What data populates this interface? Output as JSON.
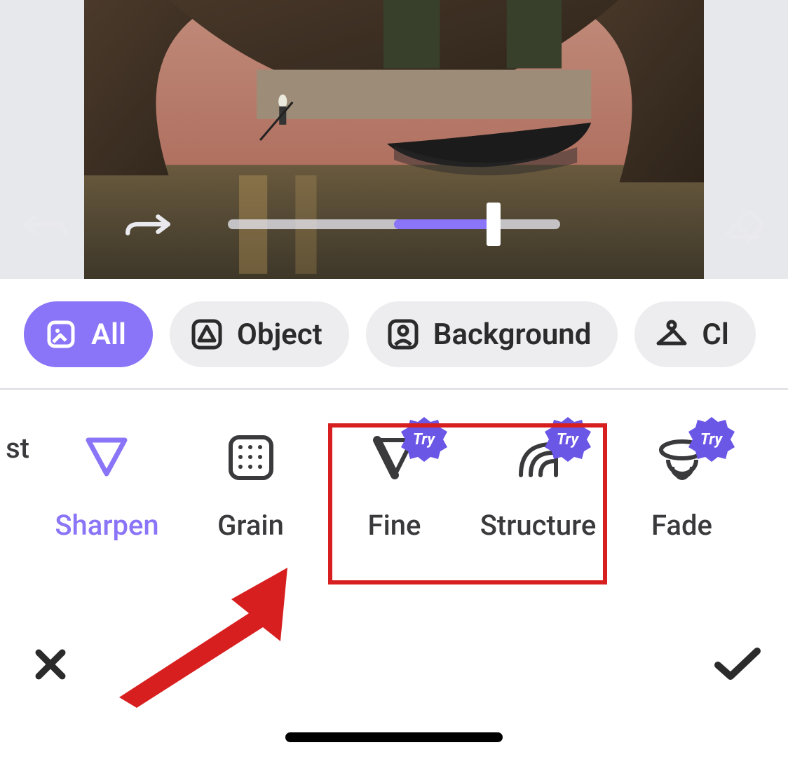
{
  "slider": {
    "center_pct": 50,
    "value_pct": 80
  },
  "scope_tabs": [
    {
      "id": "all",
      "label": "All",
      "icon": "layer-icon",
      "active": true
    },
    {
      "id": "object",
      "label": "Object",
      "icon": "object-icon",
      "active": false
    },
    {
      "id": "background",
      "label": "Background",
      "icon": "person-icon",
      "active": false
    },
    {
      "id": "clothes",
      "label": "Cl",
      "icon": "hanger-icon",
      "active": false
    }
  ],
  "effects": [
    {
      "id": "prev_cut",
      "label": "st",
      "icon": "",
      "active": false,
      "try": false
    },
    {
      "id": "sharpen",
      "label": "Sharpen",
      "icon": "triangle-down",
      "active": true,
      "try": false
    },
    {
      "id": "grain",
      "label": "Grain",
      "icon": "grain-icon",
      "active": false,
      "try": false
    },
    {
      "id": "fine",
      "label": "Fine",
      "icon": "fine-icon",
      "active": false,
      "try": true
    },
    {
      "id": "structure",
      "label": "Structure",
      "icon": "structure-icon",
      "active": false,
      "try": true
    },
    {
      "id": "fade",
      "label": "Fade",
      "icon": "fade-icon",
      "active": false,
      "try": true
    }
  ],
  "try_badge_label": "Try",
  "colors": {
    "accent": "#8a74f7",
    "pill": "#ededef",
    "red": "#d81f1f"
  }
}
